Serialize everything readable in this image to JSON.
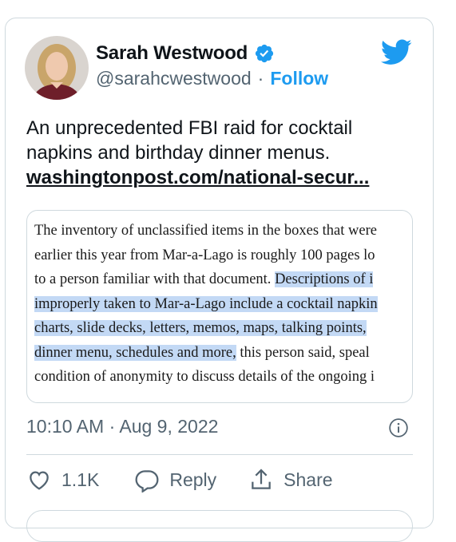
{
  "author": {
    "name": "Sarah Westwood",
    "handle": "@sarahcwestwood",
    "separator": "·",
    "follow_label": "Follow"
  },
  "tweet": {
    "text": "An unprecedented FBI raid for cocktail napkins and birthday dinner menus.",
    "link_text": "washingtonpost.com/national-secur..."
  },
  "embed": {
    "lines": [
      {
        "plain": "The inventory of unclassified items in the boxes that were",
        "highlight": "",
        "after": ""
      },
      {
        "plain": "earlier this year from Mar-a-Lago is roughly 100 pages lo",
        "highlight": "",
        "after": ""
      },
      {
        "plain": "to a person familiar with that document. ",
        "highlight": "Descriptions of i",
        "after": ""
      },
      {
        "plain": "",
        "highlight": "improperly taken to Mar-a-Lago include a cocktail napkin",
        "after": ""
      },
      {
        "plain": "",
        "highlight": "charts, slide decks, letters, memos, maps, talking points, ",
        "after": ""
      },
      {
        "plain": "",
        "highlight": "dinner menu, schedules and more,",
        "after": " this person said, speal"
      },
      {
        "plain": "condition of anonymity to discuss details of the ongoing i",
        "highlight": "",
        "after": ""
      }
    ]
  },
  "meta": {
    "timestamp": "10:10 AM · Aug 9, 2022"
  },
  "actions": {
    "like_count": "1.1K",
    "reply_label": "Reply",
    "share_label": "Share"
  },
  "colors": {
    "accent": "#1d9bf0",
    "highlight": "#c3d9f5",
    "muted": "#536471"
  }
}
